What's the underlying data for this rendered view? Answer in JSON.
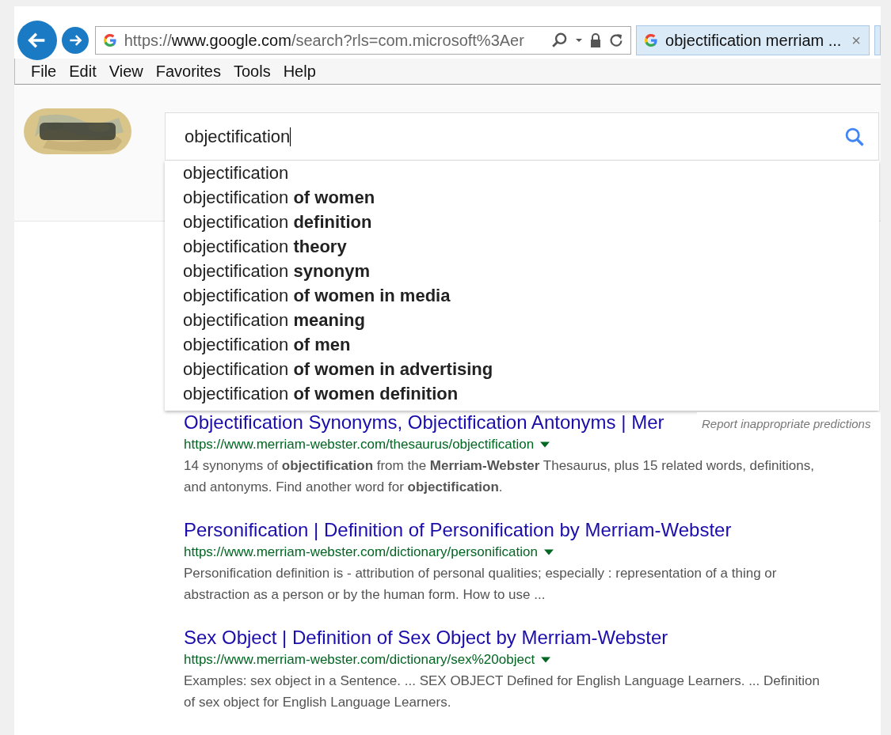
{
  "browser": {
    "address": {
      "scheme": "https://",
      "host": "www.google.com",
      "path": "/search?rls=com.microsoft%3Aer"
    },
    "tab": {
      "title": "objectification merriam ...",
      "close": "×",
      "selected": true
    },
    "menu": [
      "File",
      "Edit",
      "View",
      "Favorites",
      "Tools",
      "Help"
    ]
  },
  "search": {
    "value": "objectification",
    "suggestions": [
      "objectification",
      "objectification **of women**",
      "objectification **definition**",
      "objectification **theory**",
      "objectification **synonym**",
      "objectification **of women in media**",
      "objectification **meaning**",
      "objectification **of men**",
      "objectification **of women in advertising**",
      "objectification **of women definition**"
    ],
    "report_link": "Report inappropriate predictions"
  },
  "results": [
    {
      "title": "Objectification Synonyms, Objectification Antonyms | Mer",
      "url": "https://www.merriam-webster.com/thesaurus/objectification",
      "snippet": "14 synonyms of **objectification** from the **Merriam-Webster** Thesaurus, plus 15 related words, definitions, and antonyms. Find another word for **objectification**."
    },
    {
      "title": "Personification | Definition of Personification by Merriam-Webster",
      "url": "https://www.merriam-webster.com/dictionary/personification",
      "snippet": "Personification definition is - attribution of personal qualities; especially : representation of a thing or abstraction as a person or by the human form. How to use ..."
    },
    {
      "title": "Sex Object | Definition of Sex Object by Merriam-Webster",
      "url": "https://www.merriam-webster.com/dictionary/sex%20object",
      "snippet": "Examples: sex object in a Sentence. ... SEX OBJECT Defined for English Language Learners. ... Definition of sex object for English Language Learners."
    }
  ]
}
